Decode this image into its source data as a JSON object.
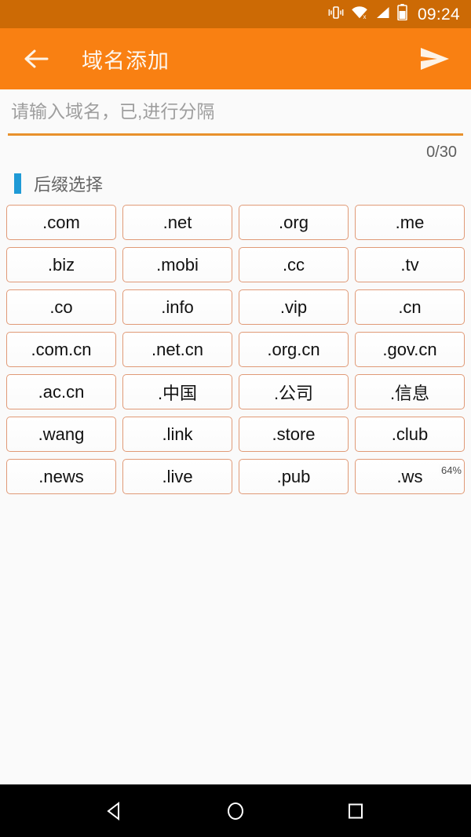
{
  "statusbar": {
    "time": "09:24",
    "icons": [
      "vibrate-icon",
      "wifi-off-icon",
      "signal-icon",
      "battery-icon"
    ]
  },
  "appbar": {
    "back_icon": "back-arrow-icon",
    "title": "域名添加",
    "send_icon": "send-icon"
  },
  "input": {
    "value": "",
    "placeholder": "请输入域名，已,进行分隔",
    "counter": "0/30"
  },
  "section": {
    "title": "后缀选择",
    "accent_color": "#1f9ad6"
  },
  "suffixes": [
    ".com",
    ".net",
    ".org",
    ".me",
    ".biz",
    ".mobi",
    ".cc",
    ".tv",
    ".co",
    ".info",
    ".vip",
    ".cn",
    ".com.cn",
    ".net.cn",
    ".org.cn",
    ".gov.cn",
    ".ac.cn",
    ".中国",
    ".公司",
    ".信息",
    ".wang",
    ".link",
    ".store",
    ".club",
    ".news",
    ".live",
    ".pub",
    ".ws"
  ],
  "overlay": {
    "battery_percent": "64%"
  },
  "navbar": {
    "back": "nav-back-icon",
    "home": "nav-home-icon",
    "recents": "nav-recents-icon"
  },
  "colors": {
    "statusbar": "#cc6a05",
    "appbar": "#f98012",
    "chip_border": "#e09a77",
    "underline": "#e8912c",
    "page_bg": "#fafafa"
  }
}
